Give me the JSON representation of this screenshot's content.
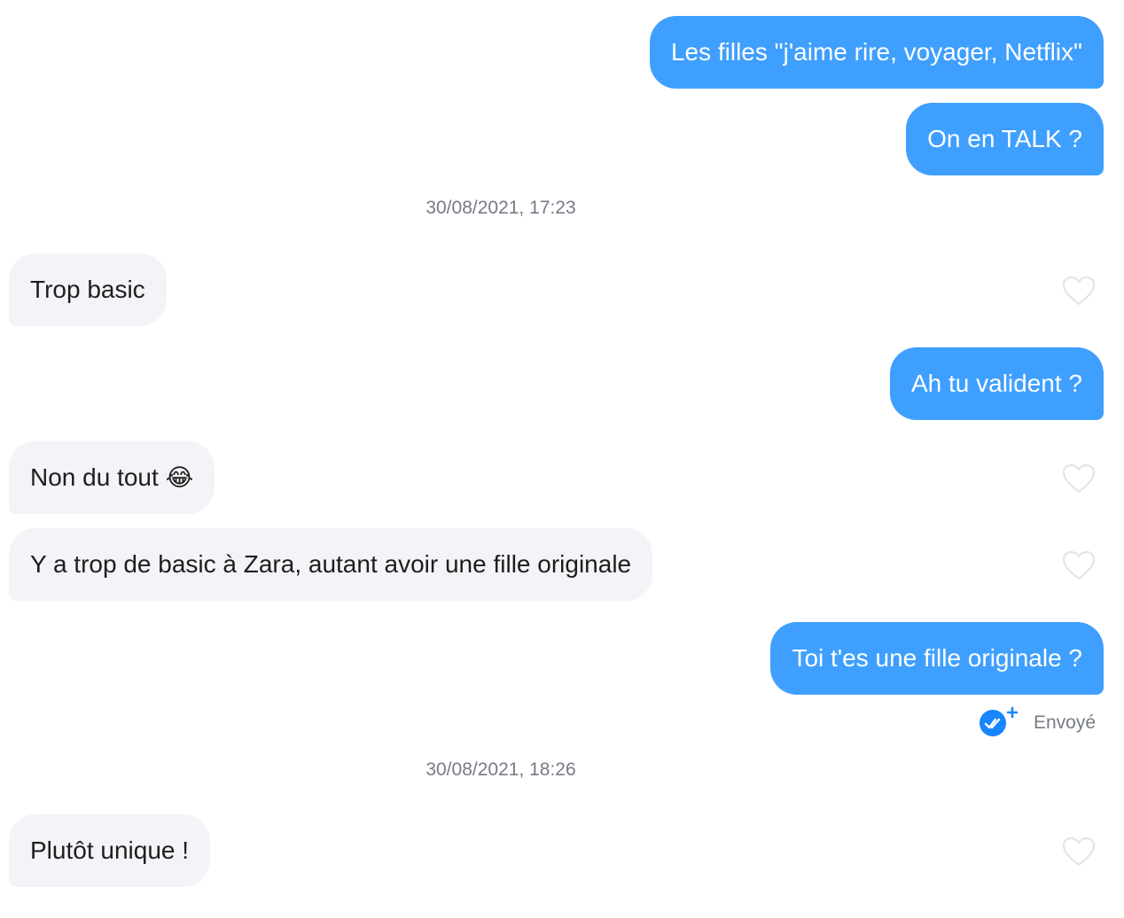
{
  "messages": [
    {
      "text": "Les filles \"j'aime rire, voyager, Netflix\""
    },
    {
      "text": "On en TALK ?"
    },
    {
      "text": "Trop basic"
    },
    {
      "text": "Ah tu valident ?"
    },
    {
      "text": "Non du tout",
      "emoji": "😂"
    },
    {
      "text": "Y a trop de basic à Zara, autant avoir une fille originale"
    },
    {
      "text": "Toi t'es une fille originale ?"
    },
    {
      "text": "Plutôt unique !"
    }
  ],
  "timestamps": [
    "30/08/2021, 17:23",
    "30/08/2021, 18:26"
  ],
  "status": {
    "label": "Envoyé",
    "icon": "double-check-plus-icon"
  },
  "colors": {
    "sent_bubble": "#3f9ffe",
    "received_bubble": "#f3f4f7",
    "meta_text": "#767b86",
    "status_icon": "#1786fe"
  },
  "icons": {
    "like": "heart-outline-icon"
  }
}
